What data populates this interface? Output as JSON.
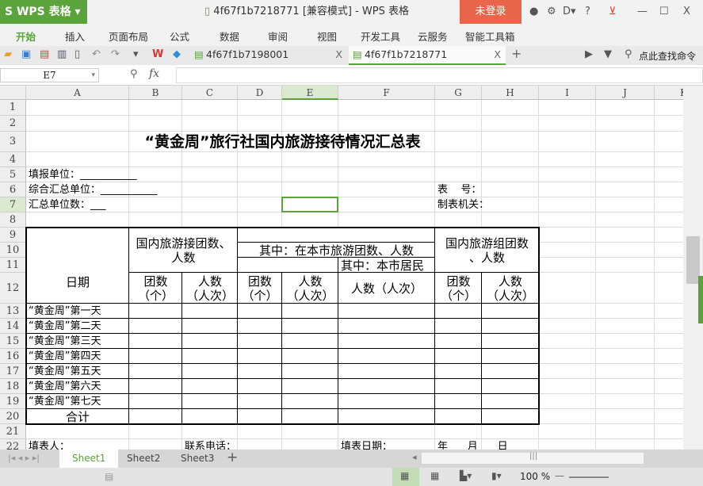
{
  "app": {
    "logo": "S WPS 表格",
    "title": "4f67f1b7218771 [兼容模式] - WPS 表格",
    "login": "未登录",
    "title_icons": [
      "skin-icon",
      "settings-icon",
      "feedback-icon",
      "help-icon",
      "download-icon",
      "minimize-icon",
      "maximize-icon",
      "close-icon"
    ],
    "help": "?",
    "minimize": "—",
    "maximize": "☐",
    "close": "X"
  },
  "menu": [
    "开始",
    "插入",
    "页面布局",
    "公式",
    "数据",
    "审阅",
    "视图",
    "开发工具",
    "云服务",
    "智能工具箱"
  ],
  "accent": "#5ba33b",
  "doc_tabs": [
    {
      "label": "4f67f1b7198001",
      "close": "X"
    },
    {
      "label": "4f67f1b7218771",
      "close": "X",
      "active": true
    }
  ],
  "search_cmd": "点此查找命令",
  "formula": {
    "cell_ref": "E7",
    "fx": "fx",
    "value": ""
  },
  "columns": [
    "A",
    "B",
    "C",
    "D",
    "E",
    "F",
    "G",
    "H",
    "I",
    "J",
    "K"
  ],
  "rows": [
    "1",
    "2",
    "3",
    "4",
    "5",
    "6",
    "7",
    "8",
    "9",
    "10",
    "11",
    "12",
    "13",
    "14",
    "15",
    "16",
    "17",
    "18",
    "19",
    "20",
    "21",
    "22"
  ],
  "selected": "E7",
  "cells": [
    {
      "r": "A3:H3",
      "t": "“黄金周”旅行社国内旅游接待情况汇总表",
      "cls": "title"
    },
    {
      "r": "A5",
      "t": "填报单位：___________",
      "al": "left"
    },
    {
      "r": "A6",
      "t": "综合汇总单位：___________",
      "al": "left"
    },
    {
      "r": "A7",
      "t": "汇总单位数：___",
      "al": "left"
    },
    {
      "r": "G6",
      "t": "表    号：",
      "al": "left"
    },
    {
      "r": "G7",
      "t": "制表机关：",
      "al": "left"
    },
    {
      "r": "A9:A12",
      "t": "日期",
      "cls": "big",
      "al": "center"
    },
    {
      "r": "B9:C11",
      "t": "国内旅游接团数、\n人数",
      "cls": "big",
      "al": "center"
    },
    {
      "r": "D10:F10",
      "t": "其中：在本市旅游团数、人数",
      "cls": "big",
      "al": "center"
    },
    {
      "r": "F11",
      "t": "其中：本市居民",
      "cls": "big",
      "al": "left"
    },
    {
      "r": "G9:H11",
      "t": "国内旅游组团数\n、人数",
      "cls": "big",
      "al": "center"
    },
    {
      "r": "B12",
      "t": "团数\n（个）",
      "cls": "big",
      "al": "center"
    },
    {
      "r": "C12",
      "t": "人数\n（人次）",
      "cls": "big",
      "al": "center"
    },
    {
      "r": "D12",
      "t": "团数\n（个）",
      "cls": "big",
      "al": "center"
    },
    {
      "r": "E12",
      "t": "人数\n（人次）",
      "cls": "big",
      "al": "center"
    },
    {
      "r": "F12",
      "t": "人数（人次）",
      "cls": "big",
      "al": "center"
    },
    {
      "r": "G12",
      "t": "团数\n（个）",
      "cls": "big",
      "al": "center"
    },
    {
      "r": "H12",
      "t": "人数\n（人次）",
      "cls": "big",
      "al": "center"
    },
    {
      "r": "A13",
      "t": "“黄金周”第一天",
      "al": "left"
    },
    {
      "r": "A14",
      "t": "“黄金周”第二天",
      "al": "left"
    },
    {
      "r": "A15",
      "t": "“黄金周”第三天",
      "al": "left"
    },
    {
      "r": "A16",
      "t": "“黄金周”第四天",
      "al": "left"
    },
    {
      "r": "A17",
      "t": "“黄金周”第五天",
      "al": "left"
    },
    {
      "r": "A18",
      "t": "“黄金周”第六天",
      "al": "left"
    },
    {
      "r": "A19",
      "t": "“黄金周”第七天",
      "al": "left"
    },
    {
      "r": "A20",
      "t": "合计",
      "cls": "big",
      "al": "center"
    },
    {
      "r": "A22",
      "t": "填表人：",
      "al": "left"
    },
    {
      "r": "C22",
      "t": "联系电话：",
      "al": "left"
    },
    {
      "r": "F22",
      "t": "填表日期：",
      "al": "left"
    },
    {
      "r": "G22",
      "t": "年      月      日",
      "al": "left"
    }
  ],
  "sheets": [
    "Sheet1",
    "Sheet2",
    "Sheet3"
  ],
  "add_sheet": "+",
  "zoom": "100 %"
}
